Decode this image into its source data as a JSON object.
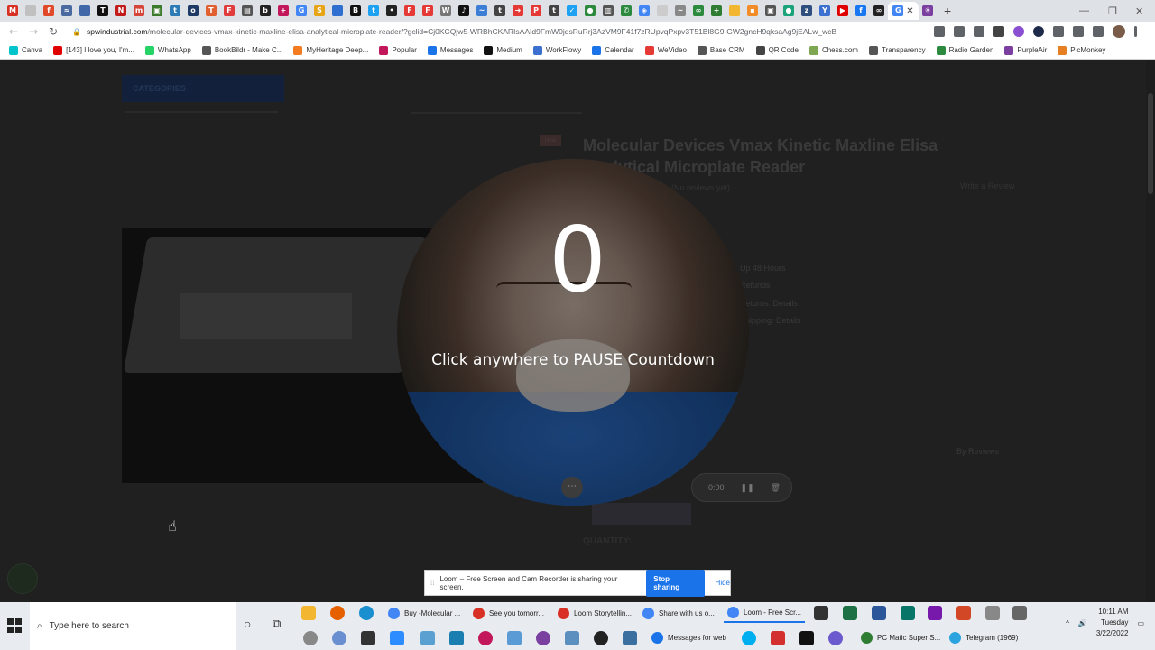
{
  "browser": {
    "tab_favicons": [
      {
        "name": "gmail-tab",
        "color": "#d93025",
        "glyph": "M"
      },
      {
        "name": "doc-tab",
        "color": "#c0c0c0",
        "glyph": ""
      },
      {
        "name": "fb-tab",
        "color": "#e04a2a",
        "glyph": "f"
      },
      {
        "name": "chart-tab",
        "color": "#4a6aa0",
        "glyph": "≈"
      },
      {
        "name": "calendar-tab",
        "color": "#4169aa",
        "glyph": ""
      },
      {
        "name": "nyt-tab",
        "color": "#111111",
        "glyph": "T"
      },
      {
        "name": "netflix-tab",
        "color": "#c11b1b",
        "glyph": "N"
      },
      {
        "name": "mail-tab",
        "color": "#d6453a",
        "glyph": "m"
      },
      {
        "name": "calc-tab",
        "color": "#3b7a2b",
        "glyph": "▣"
      },
      {
        "name": "tweet-tab",
        "color": "#2c7bb5",
        "glyph": "t"
      },
      {
        "name": "site-tab",
        "color": "#1d3a66",
        "glyph": "o"
      },
      {
        "name": "t-tab",
        "color": "#e06030",
        "glyph": "T"
      },
      {
        "name": "flip-tab",
        "color": "#e03c3c",
        "glyph": "F"
      },
      {
        "name": "news-tab",
        "color": "#555555",
        "glyph": "▤"
      },
      {
        "name": "b-tab",
        "color": "#222222",
        "glyph": "b"
      },
      {
        "name": "plus-tab",
        "color": "#c2185b",
        "glyph": "+"
      },
      {
        "name": "g-tab",
        "color": "#4285f4",
        "glyph": "G"
      },
      {
        "name": "s-tab",
        "color": "#e7a414",
        "glyph": "S"
      },
      {
        "name": "square-tab",
        "color": "#2f6fd0",
        "glyph": ""
      },
      {
        "name": "bold-tab",
        "color": "#111111",
        "glyph": "B"
      },
      {
        "name": "twitter-tab",
        "color": "#1da1f2",
        "glyph": "t"
      },
      {
        "name": "dots-tab",
        "color": "#222222",
        "glyph": "•"
      },
      {
        "name": "flipb-tab",
        "color": "#e53935",
        "glyph": "F"
      },
      {
        "name": "flipc-tab",
        "color": "#e53935",
        "glyph": "F"
      },
      {
        "name": "wiki-tab",
        "color": "#777777",
        "glyph": "W"
      },
      {
        "name": "tiktok-tab",
        "color": "#111111",
        "glyph": "♪"
      },
      {
        "name": "wave-tab",
        "color": "#3c7ed6",
        "glyph": "~"
      },
      {
        "name": "tap-tab",
        "color": "#444444",
        "glyph": "t"
      },
      {
        "name": "arrow-tab",
        "color": "#e53935",
        "glyph": "➜"
      },
      {
        "name": "p-tab",
        "color": "#e53935",
        "glyph": "P"
      },
      {
        "name": "tap2-tab",
        "color": "#444444",
        "glyph": "t"
      },
      {
        "name": "bird-tab",
        "color": "#1da1f2",
        "glyph": "✓"
      },
      {
        "name": "dot-tab",
        "color": "#2b8a3e",
        "glyph": "●"
      },
      {
        "name": "chart2-tab",
        "color": "#555555",
        "glyph": "▥"
      },
      {
        "name": "phone-tab",
        "color": "#2b8a3e",
        "glyph": "✆"
      },
      {
        "name": "drive-tab",
        "color": "#4285f4",
        "glyph": "◈"
      },
      {
        "name": "blank-tab",
        "color": "#cccccc",
        "glyph": ""
      },
      {
        "name": "grey-tab",
        "color": "#888888",
        "glyph": "~"
      },
      {
        "name": "link-tab",
        "color": "#2b8a3e",
        "glyph": "∞"
      },
      {
        "name": "green-tab",
        "color": "#2e7d32",
        "glyph": "+"
      },
      {
        "name": "folder-tab",
        "color": "#f2b630",
        "glyph": ""
      },
      {
        "name": "orange-tab",
        "color": "#f28c28",
        "glyph": "▪"
      },
      {
        "name": "car-tab",
        "color": "#555555",
        "glyph": "▣"
      },
      {
        "name": "teal-tab",
        "color": "#1aa37a",
        "glyph": "●"
      },
      {
        "name": "zen-tab",
        "color": "#2f4f7f",
        "glyph": "z"
      },
      {
        "name": "y-tab",
        "color": "#3b6fd0",
        "glyph": "Y"
      },
      {
        "name": "yt-tab",
        "color": "#e00000",
        "glyph": "▶"
      },
      {
        "name": "fbb-tab",
        "color": "#1877f2",
        "glyph": "f"
      },
      {
        "name": "loom-tab",
        "color": "#222222",
        "glyph": "∞"
      }
    ],
    "active_tab_glyph": "G",
    "active_tab_close": "✕",
    "extra_tab_glyph": "✳",
    "new_tab": "+",
    "window_controls": {
      "minimize": "—",
      "restore": "❐",
      "close": "✕"
    },
    "nav": {
      "back": "←",
      "forward": "→",
      "reload": "↻"
    },
    "url": {
      "lock": "🔒",
      "domain": "spwindustrial.com",
      "path": "/molecular-devices-vmax-kinetic-maxline-elisa-analytical-microplate-reader/?gclid=Cj0KCQjw5-WRBhCKARIsAAId9FmW0jdsRuRrj3AzVM9F41f7zRUpvqPxpv3T51Bl8G9-GW2gncH9qksaAg9jEALw_wcB"
    },
    "bookmarks": [
      {
        "label": "Canva",
        "color": "#00c4cc"
      },
      {
        "label": "[143] I love you, I'm...",
        "color": "#e00000"
      },
      {
        "label": "WhatsApp",
        "color": "#25d366"
      },
      {
        "label": "BookBildr - Make C...",
        "color": "#555555"
      },
      {
        "label": "MyHeritage Deep...",
        "color": "#f47b20"
      },
      {
        "label": "Popular",
        "color": "#c2185b"
      },
      {
        "label": "Messages",
        "color": "#1a73e8"
      },
      {
        "label": "Medium",
        "color": "#111111"
      },
      {
        "label": "WorkFlowy",
        "color": "#3b6fd0"
      },
      {
        "label": "Calendar",
        "color": "#1a73e8"
      },
      {
        "label": "WeVideo",
        "color": "#e53935"
      },
      {
        "label": "Base CRM",
        "color": "#555555"
      },
      {
        "label": "QR Code",
        "color": "#444444"
      },
      {
        "label": "Chess.com",
        "color": "#7fa650"
      },
      {
        "label": "Transparency",
        "color": "#555555"
      },
      {
        "label": "Radio Garden",
        "color": "#2b8a3e"
      },
      {
        "label": "PurpleAir",
        "color": "#7b3fa0"
      },
      {
        "label": "PicMonkey",
        "color": "#e67e22"
      }
    ]
  },
  "page": {
    "categories_label": "CATEGORIES",
    "new_badge": "New",
    "product_title": "Molecular Devices Vmax Kinetic Maxline Elisa Analytical Microplate Reader",
    "reviews": "(No reviews yet)",
    "write_review": "Write a Review",
    "meta_links": [
      "Up 48 Hours",
      "Refunds",
      "Returns: Details",
      "Shipping: Details"
    ],
    "quantity_label": "QUANTITY:",
    "byline": "By Reviews"
  },
  "loom": {
    "countdown": "0",
    "pause_message": "Click anywhere to PAUSE Countdown",
    "more_glyph": "⋯",
    "timer": "0:00",
    "pause_glyph": "❚❚",
    "trash_glyph": "🗑",
    "share_bar": {
      "grip": "⁞⁞",
      "message": "Loom – Free Screen and Cam Recorder is sharing your screen.",
      "stop_label": "Stop sharing",
      "hide_label": "Hide"
    }
  },
  "taskbar": {
    "search_placeholder": "Type here to search",
    "search_icon": "⌕",
    "cortana_icon": "○",
    "taskview_icon": "⧉",
    "windows": [
      {
        "label": "Buy -Molecular ...",
        "color": "#4285f4"
      },
      {
        "label": "See you tomorr...",
        "color": "#d93025"
      },
      {
        "label": "Loom Storytellin...",
        "color": "#d93025"
      },
      {
        "label": "Share with us o...",
        "color": "#4285f4"
      },
      {
        "label": "Loom - Free Scr...",
        "color": "#4285f4"
      },
      {
        "label": "Messages for web",
        "color": "#1a73e8"
      },
      {
        "label": "PC Matic Super S...",
        "color": "#2e7d32"
      },
      {
        "label": "Telegram (1969)",
        "color": "#2aa3df"
      }
    ],
    "tray_chevron": "^",
    "volume_icon": "🔊",
    "notification_icon": "▭",
    "time": "10:11 AM",
    "day": "Tuesday",
    "date": "3/22/2022"
  }
}
